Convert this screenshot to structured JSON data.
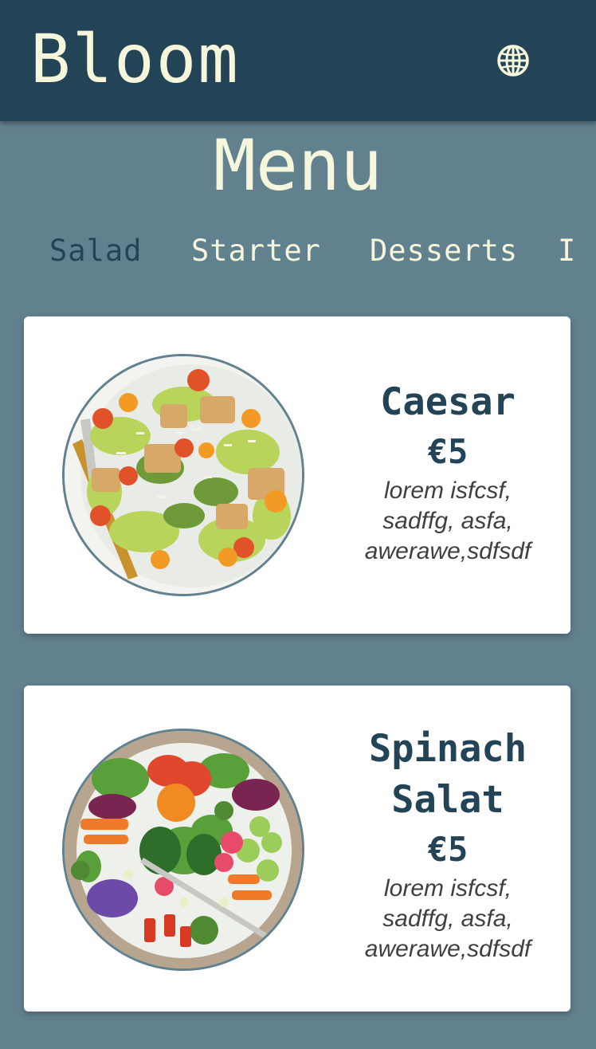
{
  "header": {
    "brand": "Bloom",
    "language_icon": "globe-icon"
  },
  "page_title": "Menu",
  "tabs": [
    {
      "label": "Salad",
      "active": true
    },
    {
      "label": "Starter",
      "active": false
    },
    {
      "label": "Desserts",
      "active": false
    },
    {
      "label": "I",
      "active": false
    }
  ],
  "items": [
    {
      "name_lines": [
        "Caesar"
      ],
      "price": "€5",
      "description": "lorem isfcsf, sadffg, asfa, awerawe,sdfsdf",
      "image": "caesar-salad-photo"
    },
    {
      "name_lines": [
        "Spinach",
        "Salat"
      ],
      "price": "€5",
      "description": "lorem isfcsf, sadffg, asfa, awerawe,sdfsdf",
      "image": "spinach-salad-photo"
    }
  ],
  "colors": {
    "header_bg": "#234457",
    "page_bg": "#62818f",
    "accent_text": "#f6f6dd",
    "dark_text": "#234457"
  }
}
